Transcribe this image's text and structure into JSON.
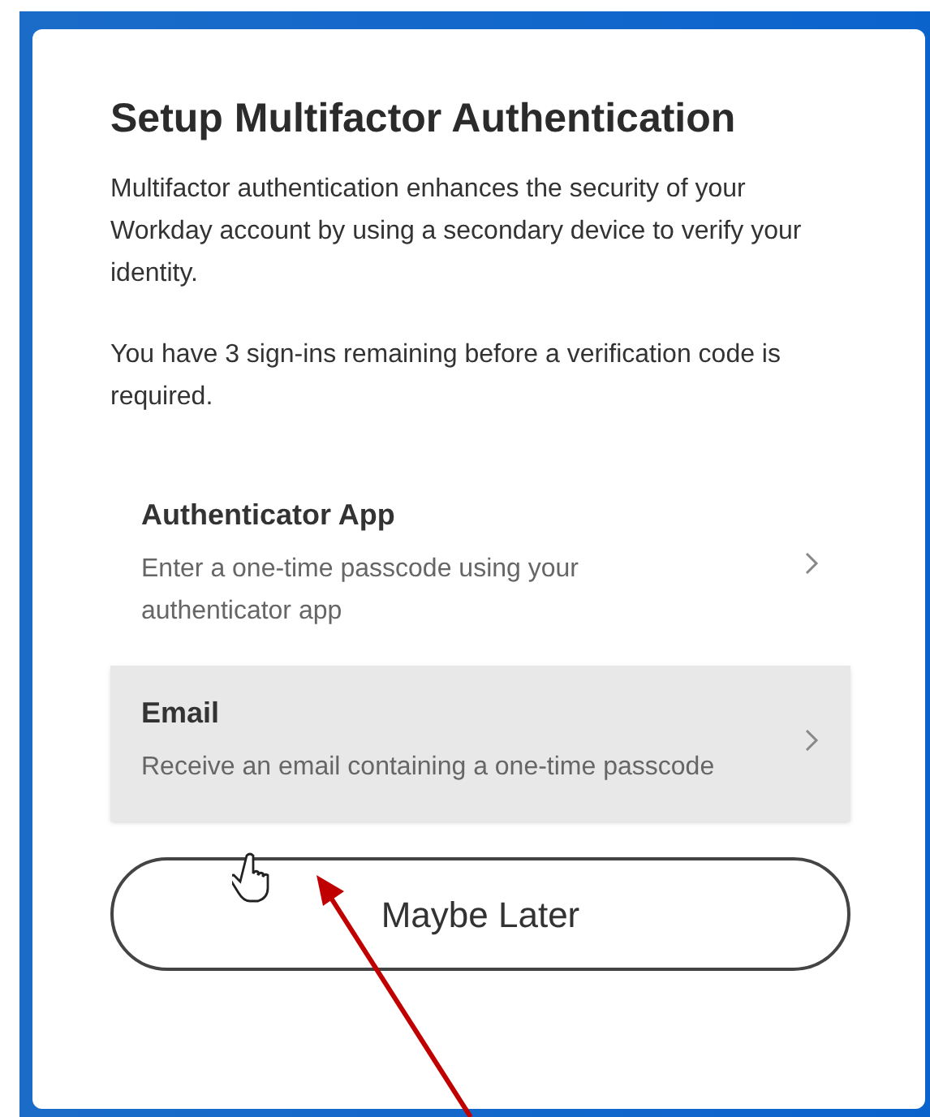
{
  "dialog": {
    "title": "Setup Multifactor Authentication",
    "paragraphs": [
      "Multifactor authentication enhances the security of your Workday account by using a secondary device to verify your identity.",
      "You have 3 sign-ins remaining before a verification code is required."
    ],
    "options": [
      {
        "title": "Authenticator App",
        "description": "Enter a one-time passcode using your authenticator app",
        "selected": false
      },
      {
        "title": "Email",
        "description": "Receive an email containing a one-time passcode",
        "selected": true
      }
    ],
    "button": "Maybe Later"
  }
}
